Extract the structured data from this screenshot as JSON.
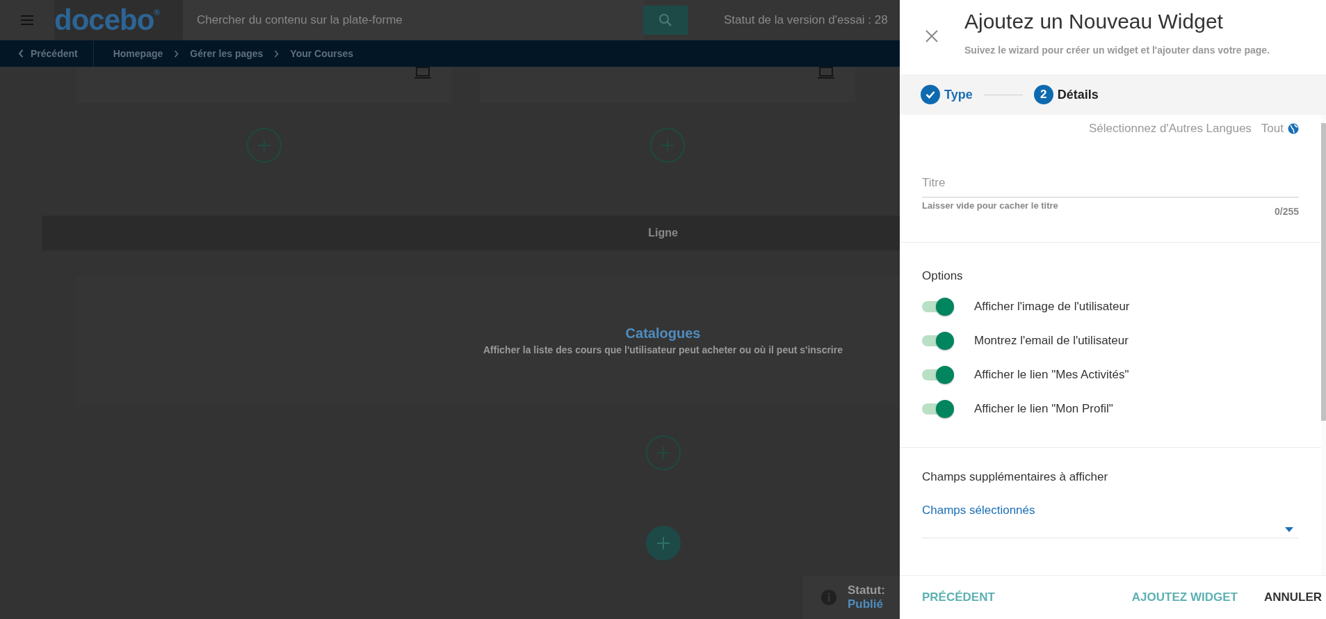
{
  "top_bar": {
    "logo": "docebo$^{®}$",
    "search": {
      "placeholder": "Chercher du contenu sur la plate-forme"
    },
    "trial_status": "Statut de la version d'essai : 28"
  },
  "breadcrumb": {
    "back": "Précédent",
    "items": [
      "Homepage",
      "Gérer les pages",
      "Your Courses"
    ]
  },
  "page": {
    "row_label": "Ligne",
    "widget": {
      "title": "Catalogues",
      "description": "Afficher la liste des cours que l'utilisateur peut acheter ou où il peut s'inscrire"
    }
  },
  "status": {
    "label": "Statut:",
    "value": "Publié"
  },
  "panel": {
    "title": "Ajoutez un Nouveau Widget",
    "subtitle": "Suivez le wizard pour créer un widget et l'ajouter dans votre page.",
    "steps": [
      {
        "label": "Type",
        "completed": true,
        "selected": false
      },
      {
        "number": "2",
        "label": "Détails",
        "completed": false,
        "selected": true
      }
    ],
    "language": {
      "label": "Sélectionnez d'Autres Langues",
      "value": "Tout"
    },
    "title_field": {
      "placeholder": "Titre",
      "hint": "Laisser vide pour cacher le titre",
      "counter": "0/255"
    },
    "options": {
      "heading": "Options",
      "toggles": [
        {
          "label": "Afficher l'image de l'utilisateur",
          "on": true
        },
        {
          "label": "Montrez l'email de l'utilisateur",
          "on": true
        },
        {
          "label": "Afficher le lien \"Mes Activités\"",
          "on": true
        },
        {
          "label": "Afficher le lien \"Mon Profil\"",
          "on": true
        }
      ]
    },
    "extra_fields": {
      "heading": "Champs supplémentaires à afficher",
      "dropdown": {
        "label": "Champs sélectionnés"
      }
    },
    "buttons": [
      {
        "label": "PRÉCÉDENT",
        "kind": "accent"
      },
      {
        "label": "AJOUTEZ WIDGET",
        "kind": "accent"
      },
      {
        "label": "ANNULER",
        "kind": "plain"
      }
    ]
  }
}
